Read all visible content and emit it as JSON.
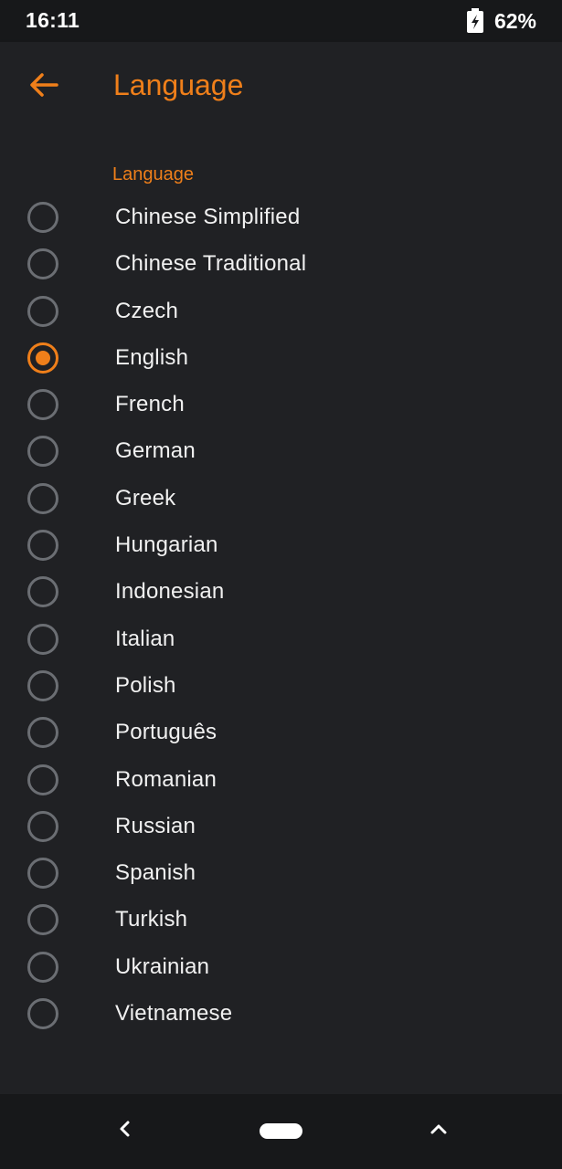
{
  "status_bar": {
    "time": "16:11",
    "battery": "62%",
    "battery_icon": "battery-charging-icon"
  },
  "app_bar": {
    "title": "Language",
    "back_icon": "arrow-back-icon"
  },
  "section": {
    "header": "Language"
  },
  "languages": [
    {
      "label": "Chinese Simplified",
      "selected": false
    },
    {
      "label": "Chinese Traditional",
      "selected": false
    },
    {
      "label": "Czech",
      "selected": false
    },
    {
      "label": "English",
      "selected": true
    },
    {
      "label": "French",
      "selected": false
    },
    {
      "label": "German",
      "selected": false
    },
    {
      "label": "Greek",
      "selected": false
    },
    {
      "label": "Hungarian",
      "selected": false
    },
    {
      "label": "Indonesian",
      "selected": false
    },
    {
      "label": "Italian",
      "selected": false
    },
    {
      "label": "Polish",
      "selected": false
    },
    {
      "label": "Português",
      "selected": false
    },
    {
      "label": "Romanian",
      "selected": false
    },
    {
      "label": "Russian",
      "selected": false
    },
    {
      "label": "Spanish",
      "selected": false
    },
    {
      "label": "Turkish",
      "selected": false
    },
    {
      "label": "Ukrainian",
      "selected": false
    },
    {
      "label": "Vietnamese",
      "selected": false
    }
  ],
  "nav_bar": {
    "back_icon": "chevron-left-icon",
    "home_icon": "home-pill-icon",
    "up_icon": "chevron-up-icon"
  },
  "colors": {
    "accent": "#ef7f1a",
    "background": "#202124",
    "status_bar": "#17181a",
    "text": "#f1f1f1",
    "radio_unchecked": "#6b6e73"
  }
}
